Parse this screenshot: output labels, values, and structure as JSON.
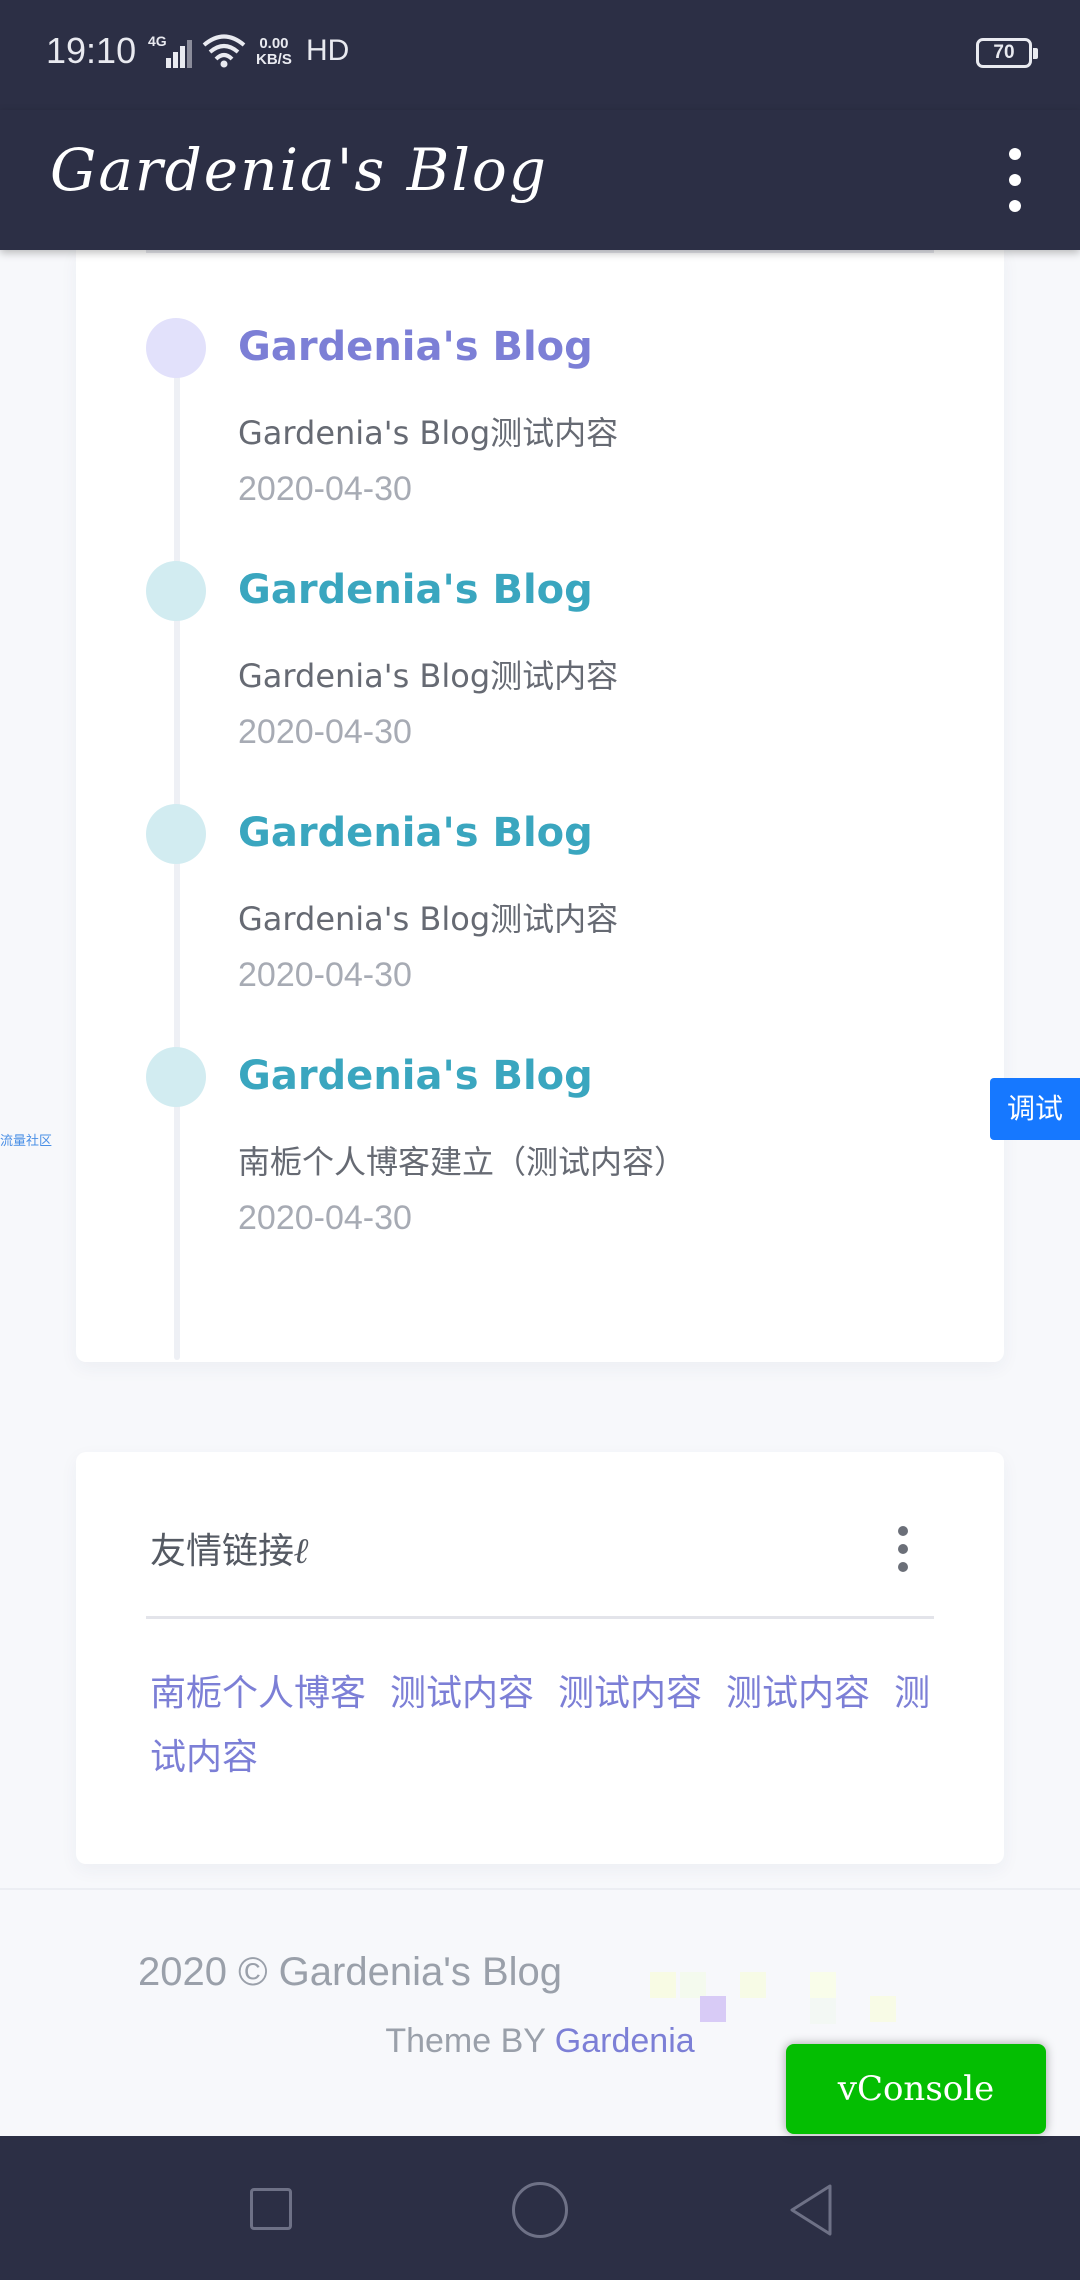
{
  "status_bar": {
    "time": "19:10",
    "network": "4G",
    "speed_value": "0.00",
    "speed_unit": "KB/S",
    "hd": "HD",
    "battery": "70"
  },
  "app_bar": {
    "title": "Gardenia's Blog",
    "menu_icon": "more-vertical-icon"
  },
  "timeline": {
    "items": [
      {
        "title": "Gardenia's Blog",
        "desc": "Gardenia's Blog测试内容",
        "date": "2020-04-30",
        "title_color": "#7c7fd6",
        "dot_color": "#e2e1fb"
      },
      {
        "title": "Gardenia's Blog",
        "desc": "Gardenia's Blog测试内容",
        "date": "2020-04-30",
        "title_color": "#3aa6bf",
        "dot_color": "#d2ecf1"
      },
      {
        "title": "Gardenia's Blog",
        "desc": "Gardenia's Blog测试内容",
        "date": "2020-04-30",
        "title_color": "#3aa6bf",
        "dot_color": "#d2ecf1"
      },
      {
        "title": "Gardenia's Blog",
        "desc": "南栀个人博客建立（测试内容）",
        "date": "2020-04-30",
        "title_color": "#3aa6bf",
        "dot_color": "#d2ecf1"
      }
    ]
  },
  "friend_links": {
    "heading": "友情链接",
    "links": [
      "南栀个人博客",
      "测试内容",
      "测试内容",
      "测试内容",
      "测试内容"
    ]
  },
  "footer": {
    "copyright": "2020 © Gardenia's Blog",
    "theme_prefix": "Theme BY",
    "theme_author": "Gardenia"
  },
  "side_left_text": "流量社区",
  "debug_tab": "调试",
  "vconsole": "vConsole",
  "colors": {
    "header_bg": "#2c2f45",
    "accent": "#7c7fd6",
    "teal": "#3aa6bf",
    "vconsole_green": "#04be02",
    "debug_blue": "#1678ff"
  }
}
